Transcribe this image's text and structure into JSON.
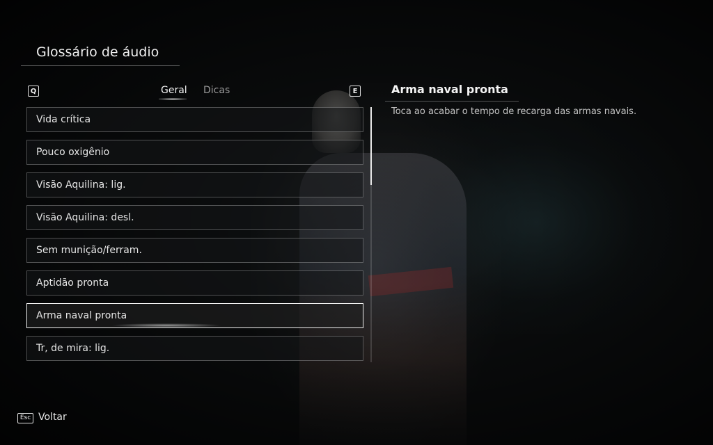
{
  "header": {
    "title": "Glossário de áudio"
  },
  "tabs": {
    "prev_key": "Q",
    "next_key": "E",
    "items": [
      {
        "label": "Geral",
        "active": true
      },
      {
        "label": "Dicas",
        "active": false
      }
    ]
  },
  "list": {
    "items": [
      {
        "label": "Vida crítica"
      },
      {
        "label": "Pouco oxigênio"
      },
      {
        "label": "Visão Aquilina: lig."
      },
      {
        "label": "Visão Aquilina: desl."
      },
      {
        "label": "Sem munição/ferram."
      },
      {
        "label": "Aptidão pronta"
      },
      {
        "label": "Arma naval pronta",
        "selected": true
      },
      {
        "label": "Tr, de mira: lig."
      }
    ]
  },
  "detail": {
    "title": "Arma naval pronta",
    "description": "Toca ao acabar o tempo de recarga das armas navais."
  },
  "footer": {
    "back_key": "Esc",
    "back_label": "Voltar"
  }
}
